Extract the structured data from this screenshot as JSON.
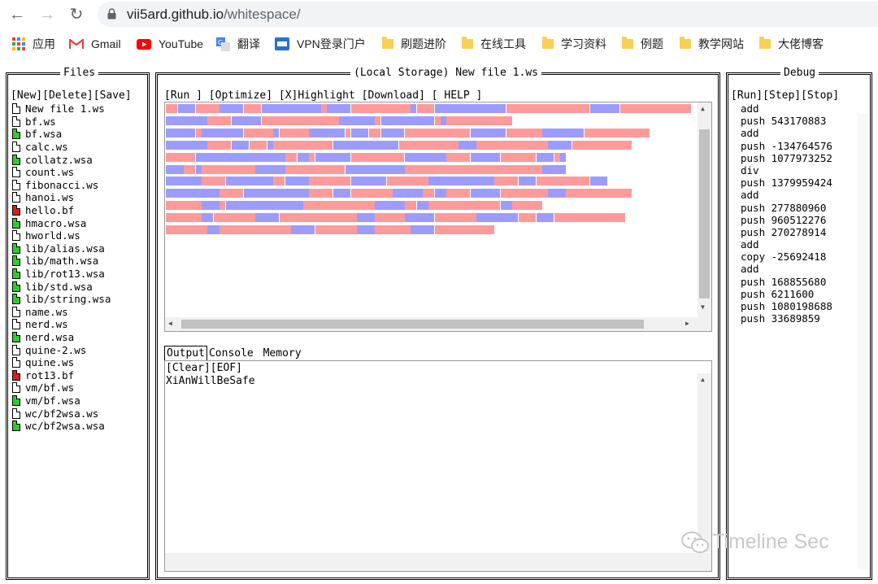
{
  "browser": {
    "url_host": "vii5ard.github.io",
    "url_path": "/whitespace/",
    "bookmarks": [
      {
        "label": "应用",
        "icon": "apps-grid-icon"
      },
      {
        "label": "Gmail",
        "icon": "gmail-icon"
      },
      {
        "label": "YouTube",
        "icon": "youtube-icon"
      },
      {
        "label": "翻译",
        "icon": "translate-icon"
      },
      {
        "label": "VPN登录门户",
        "icon": "vpn-icon"
      },
      {
        "label": "刷题进阶",
        "icon": "folder-icon"
      },
      {
        "label": "在线工具",
        "icon": "folder-icon"
      },
      {
        "label": "学习资料",
        "icon": "folder-icon"
      },
      {
        "label": "例题",
        "icon": "folder-icon"
      },
      {
        "label": "教学网站",
        "icon": "folder-icon"
      },
      {
        "label": "大佬博客",
        "icon": "folder-icon"
      }
    ]
  },
  "files": {
    "title": "Files",
    "menu": "[New][Delete][Save]",
    "items": [
      {
        "name": "New file 1.ws",
        "type": "plain"
      },
      {
        "name": "bf.ws",
        "type": "plain"
      },
      {
        "name": "bf.wsa",
        "type": "green"
      },
      {
        "name": "calc.ws",
        "type": "plain"
      },
      {
        "name": "collatz.wsa",
        "type": "green"
      },
      {
        "name": "count.ws",
        "type": "plain"
      },
      {
        "name": "fibonacci.ws",
        "type": "plain"
      },
      {
        "name": "hanoi.ws",
        "type": "plain"
      },
      {
        "name": "hello.bf",
        "type": "red"
      },
      {
        "name": "hmacro.wsa",
        "type": "green"
      },
      {
        "name": "hworld.ws",
        "type": "plain"
      },
      {
        "name": "lib/alias.wsa",
        "type": "green"
      },
      {
        "name": "lib/math.wsa",
        "type": "green"
      },
      {
        "name": "lib/rot13.wsa",
        "type": "green"
      },
      {
        "name": "lib/std.wsa",
        "type": "green"
      },
      {
        "name": "lib/string.wsa",
        "type": "green"
      },
      {
        "name": "name.ws",
        "type": "plain"
      },
      {
        "name": "nerd.ws",
        "type": "plain"
      },
      {
        "name": "nerd.wsa",
        "type": "green"
      },
      {
        "name": "quine-2.ws",
        "type": "plain"
      },
      {
        "name": "quine.ws",
        "type": "plain"
      },
      {
        "name": "rot13.bf",
        "type": "red"
      },
      {
        "name": "vm/bf.ws",
        "type": "plain"
      },
      {
        "name": "vm/bf.wsa",
        "type": "green"
      },
      {
        "name": "wc/bf2wsa.ws",
        "type": "plain"
      },
      {
        "name": "wc/bf2wsa.wsa",
        "type": "green"
      }
    ]
  },
  "editor": {
    "title": "(Local Storage) New file 1.ws",
    "menu": "[Run ] [Optimize] [X]Highlight [Download] [ HELP ]",
    "tabs": {
      "output": "Output",
      "console": "Console",
      "memory": "Memory"
    },
    "output_menu": "[Clear][EOF]",
    "output_text": "XiAnWillBeSafe"
  },
  "debug": {
    "title": "Debug",
    "menu": "[Run][Step][Stop]",
    "lines": [
      "add",
      "push 543170883",
      "add",
      "push -134764576",
      "push 1077973252",
      "div",
      "push 1379959424",
      "add",
      "push 277880960",
      "push 960512276",
      "push 270278914",
      "add",
      "copy -25692418",
      "add",
      "push 168855680",
      "push 6211600",
      "push 1080198688",
      "push 33689859"
    ]
  },
  "watermark": "Timeline Sec",
  "colors": {
    "space": "#ff9a9a",
    "tab": "#9c9cff",
    "green_file": "#2ccd2c",
    "red_file": "#dd1c1c"
  }
}
